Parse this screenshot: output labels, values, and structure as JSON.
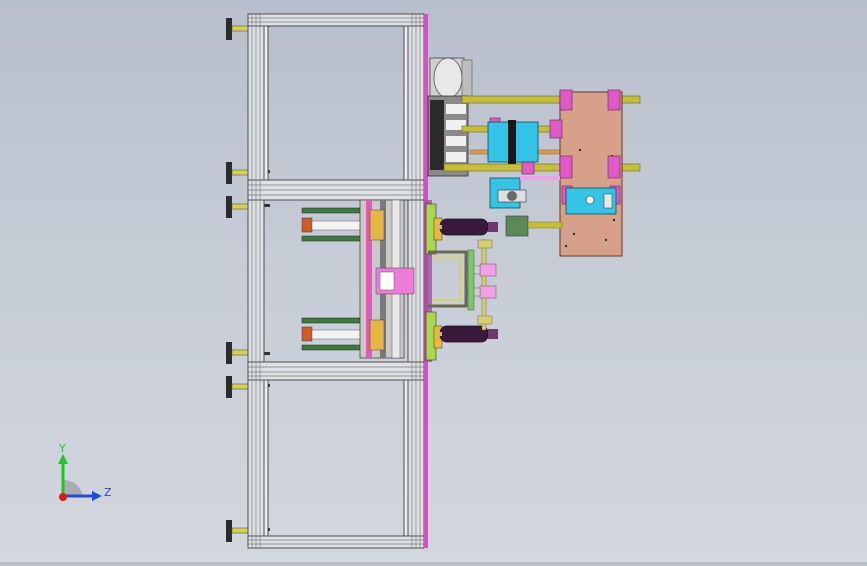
{
  "viewport": {
    "background_top": "#b6bfcc",
    "background_bottom": "#d3d7de"
  },
  "triad": {
    "y_label": "Y",
    "z_label": "Z",
    "y_color": "#22c32a",
    "z_color": "#1f4fd8",
    "origin_color": "#e01818"
  },
  "colors": {
    "frame": "#6b6b6b",
    "frame_light": "#d9dcdf",
    "magenta": "#e060c8",
    "yellow_rod": "#c9c23a",
    "plate_tan": "#d8a08c",
    "cyan": "#2cc8e0",
    "dark_cyl": "#3a1e3a",
    "green_part": "#6ad06a",
    "olive": "#b3b04a"
  }
}
